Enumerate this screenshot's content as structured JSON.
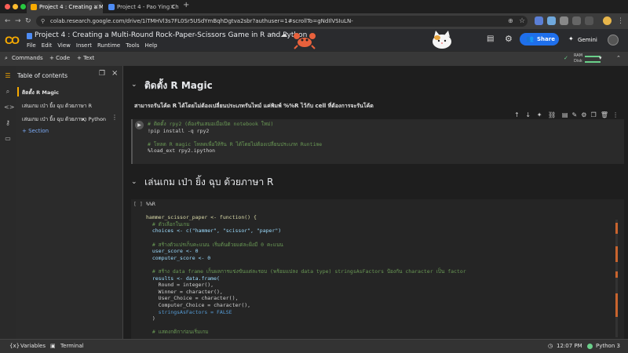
{
  "browser": {
    "tabs": [
      {
        "title": "Project 4 : Creating a Multi-R",
        "active": true
      },
      {
        "title": "Project 4 - Pao Ying Chub",
        "active": false
      }
    ],
    "new_tab_symbol": "+",
    "url": "colab.research.google.com/drive/1iTMHVl3s7FL0Sr5USdYmBqhDgtva2sbr?authuser=1#scrollTo=gNdIlVSIuLN-"
  },
  "header": {
    "logo": "CO",
    "title": "Project 4 : Creating a Multi-Round Rock-Paper-Scissors Game in  R and  Python",
    "menu": [
      "File",
      "Edit",
      "View",
      "Insert",
      "Runtime",
      "Tools",
      "Help"
    ],
    "share_label": "Share",
    "gemini_label": "Gemini"
  },
  "toolbar": {
    "commands_label": "Commands",
    "code_label": "+ Code",
    "text_label": "+ Text",
    "ram_label": "RAM",
    "disk_label": "Disk"
  },
  "sidebar": {
    "title": "Table of contents",
    "items": [
      {
        "label": "ติดตั้ง R Magic",
        "active": true
      },
      {
        "label": "เล่นเกม เป่า ยิ้ง ฉุบ ด้วยภาษา R",
        "active": false
      },
      {
        "label": "เล่นเกม เป่า ยิ้ง ฉุบ ด้วยภาษา Python",
        "active": false
      }
    ],
    "add_section_label": "+ Section"
  },
  "notebook": {
    "section1_title": "ติดตั้ง R Magic",
    "text_cell": "สามารถรันโค้ด R ได้โดยไม่ต้องเปลี่ยนประเภทรันไทม์ แค่พิมพ์ %%R ไว้กับ cell ที่ต้องการจะรันโค้ด",
    "cell1_lines": [
      "# ติดตั้ง rpy2 (ต้องรันเสมอเมื่อเปิด notebook ใหม่)",
      "!pip install -q rpy2",
      "",
      "# โหลด R magic โหลดเพื่อให้รัน R ได้โดยไม่ต้องเปลี่ยนประเภท Runtime",
      "%load_ext rpy2.ipython"
    ],
    "section2_title": "เล่นเกม เป่า ยิ้ง ฉุบ ด้วยภาษา R",
    "cell2_exec": "[ ]",
    "cell2_lines": [
      "%%R",
      "",
      "hammer_scissor_paper <- function() {",
      "  # ตัวเลือกในเกม",
      "  choices <- c(\"hammer\", \"scissor\", \"paper\")",
      "",
      "  # สร้างตัวแปรเก็บคะแนน เริ่มต้นด้วยแต่ละฝั่งมี 0 คะแนน",
      "  user_score <- 0",
      "  computer_score <- 0",
      "",
      "  # สร้าง data frame เก็บผลการแข่งขันแต่ละรอบ (พร้อมแปลง data type) stringsAsFactors ป้องกัน character เป็น factor",
      "  results <- data.frame(",
      "    Round = integer(),",
      "    Winner = character(),",
      "    User_Choice = character(),",
      "    Computer_Choice = character(),",
      "    stringsAsFactors = FALSE",
      "  )",
      "",
      "  # แสดงกติกาก่อนเริ่มเกม"
    ]
  },
  "status": {
    "variables_label": "Variables",
    "terminal_label": "Terminal",
    "time": "12:07 PM",
    "runtime": "Python 3"
  }
}
